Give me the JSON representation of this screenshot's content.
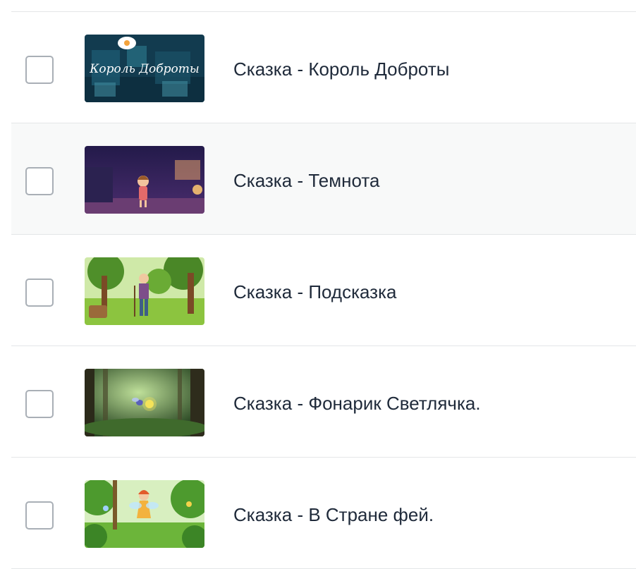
{
  "items": [
    {
      "title": "Сказка - Король Доброты",
      "checked": false,
      "highlighted": false,
      "thumbnail": {
        "icon": "king-of-kindness-thumbnail",
        "caption": "Король Доброты"
      }
    },
    {
      "title": "Сказка - Темнота",
      "checked": false,
      "highlighted": true,
      "thumbnail": {
        "icon": "darkness-room-thumbnail"
      }
    },
    {
      "title": "Сказка - Подсказка",
      "checked": false,
      "highlighted": false,
      "thumbnail": {
        "icon": "forest-old-man-thumbnail"
      }
    },
    {
      "title": "Сказка - Фонарик Светлячка.",
      "checked": false,
      "highlighted": false,
      "thumbnail": {
        "icon": "firefly-forest-thumbnail"
      }
    },
    {
      "title": "Сказка - В Стране фей.",
      "checked": false,
      "highlighted": false,
      "thumbnail": {
        "icon": "fairy-land-thumbnail"
      }
    }
  ],
  "colors": {
    "text": "#1f2a3a",
    "divider": "#e4e6e8",
    "highlight_row": "#f8f9f9",
    "checkbox_border": "#a9afb6"
  }
}
